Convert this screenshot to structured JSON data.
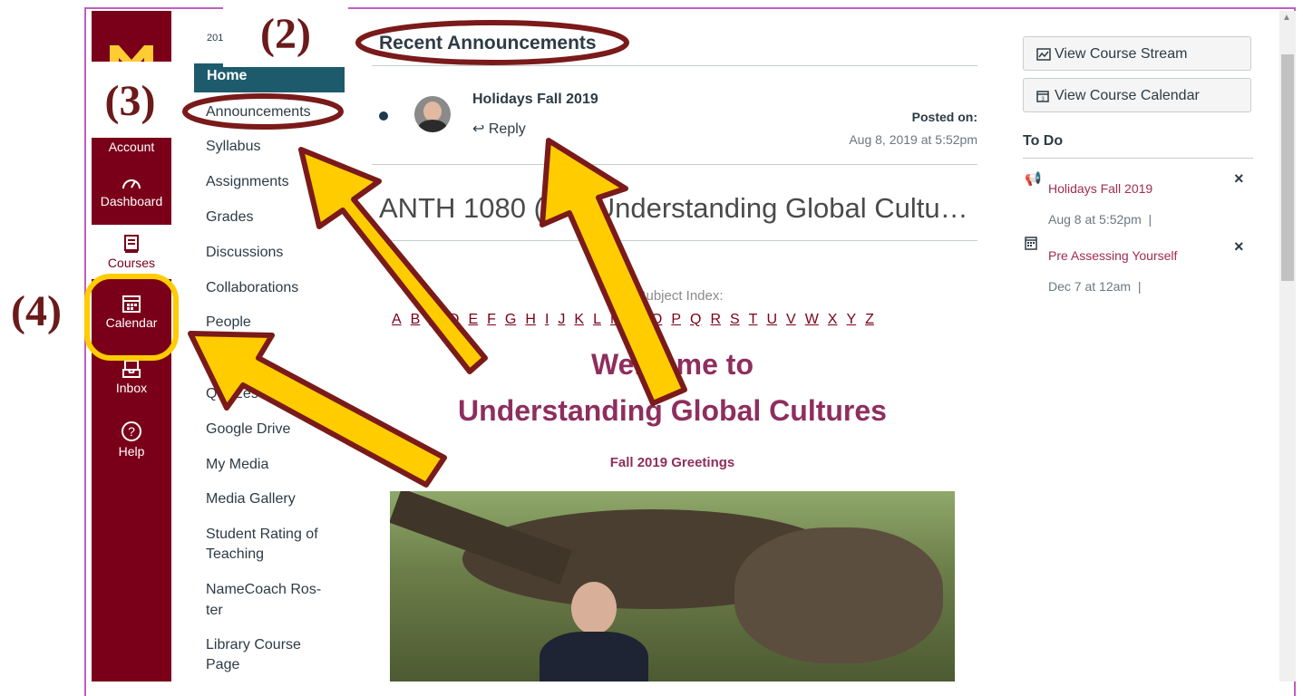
{
  "overlays": {
    "label2": "(2)",
    "label3": "(3)",
    "label4": "(4)"
  },
  "global_nav": {
    "items": [
      {
        "label": "Account"
      },
      {
        "label": "Dashboard"
      },
      {
        "label": "Courses"
      },
      {
        "label": "Calendar"
      },
      {
        "label": "Inbox"
      },
      {
        "label": "Help"
      }
    ]
  },
  "course_nav": {
    "term_prefix": "201",
    "items": [
      "Home",
      "Announcements",
      "Syllabus",
      "Assignments",
      "Grades",
      "Discussions",
      "Collaborations",
      "People",
      "Quizzes",
      "Google Drive",
      "My Media",
      "Media Gallery",
      "Student Rating of",
      "Teaching",
      "NameCoach Ros-",
      "ter",
      "Library Course",
      "Page"
    ]
  },
  "main": {
    "section_title": "Recent Announcements",
    "announcement": {
      "title": "Holidays Fall 2019",
      "reply": "Reply",
      "posted_label": "Posted on:",
      "posted_date": "Aug 8, 2019 at 5:52pm"
    },
    "course_title": "ANTH 1080 (0… Understanding Global Cultu…",
    "subject_index_label": "Subject Index:",
    "alphabet": [
      "A",
      "B",
      "C",
      "D",
      "E",
      "F",
      "G",
      "H",
      "I",
      "J",
      "K",
      "L",
      "M",
      "N",
      "O",
      "P",
      "Q",
      "R",
      "S",
      "T",
      "U",
      "V",
      "W",
      "X",
      "Y",
      "Z"
    ],
    "welcome_line1": "Welcome to",
    "welcome_line2": "Understanding Global Cultures",
    "greeting": "Fall 2019 Greetings"
  },
  "sidebar": {
    "stream_button": "View Course Stream",
    "calendar_button": "View Course Calendar",
    "todo_heading": "To Do",
    "todos": [
      {
        "title": "Holidays Fall 2019",
        "date": "Aug 8 at 5:52pm",
        "sep": "|",
        "dismiss": "×"
      },
      {
        "title": "Pre Assessing Yourself",
        "date": "Dec 7 at 12am",
        "sep": "|",
        "dismiss": "×"
      }
    ]
  },
  "colors": {
    "brand": "#7a0019",
    "accent": "#ffcc00",
    "link": "#a12d4f",
    "home_bg": "#1d5b6c"
  }
}
